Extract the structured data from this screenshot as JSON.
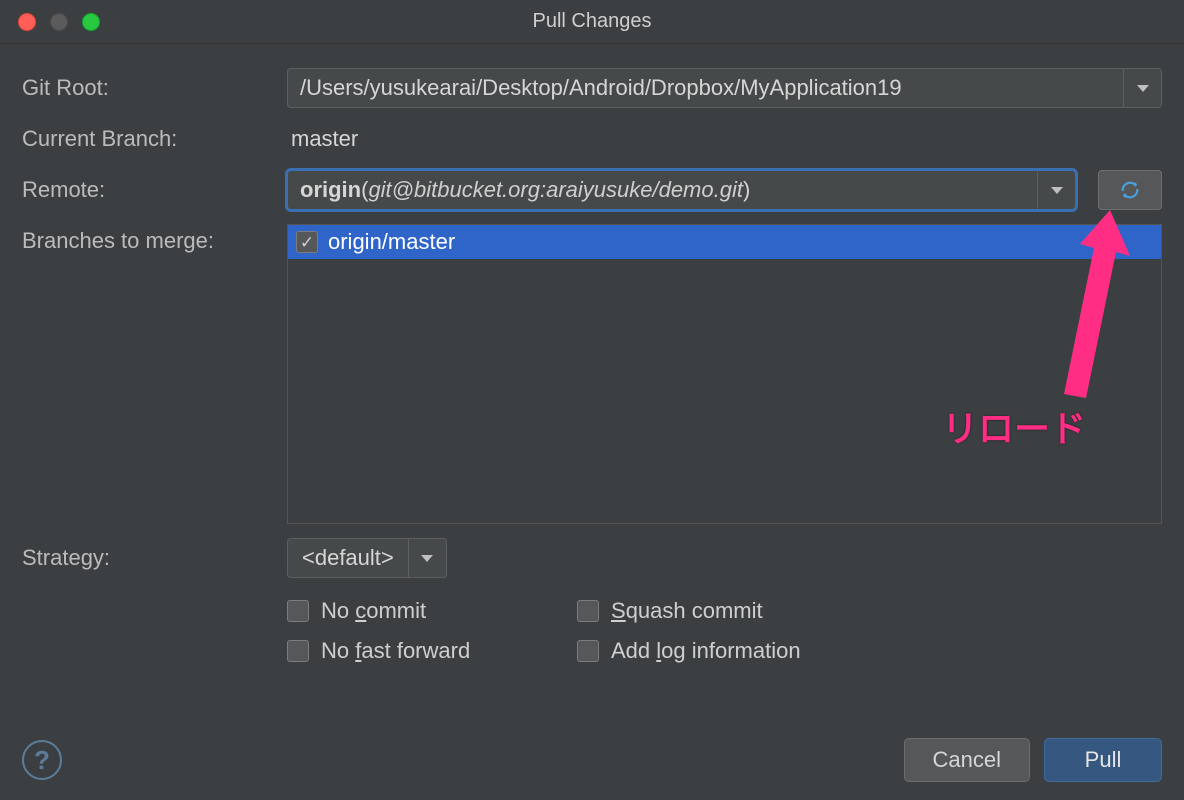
{
  "window": {
    "title": "Pull Changes"
  },
  "labels": {
    "git_root": "Git Root:",
    "current_branch": "Current Branch:",
    "remote": "Remote:",
    "branches_to_merge": "Branches to merge:",
    "strategy": "Strategy:"
  },
  "git_root": {
    "value": "/Users/yusukearai/Desktop/Android/Dropbox/MyApplication19"
  },
  "current_branch": "master",
  "remote": {
    "name": "origin",
    "url": "git@bitbucket.org:araiyusuke/demo.git"
  },
  "branches": [
    {
      "label": "origin/master",
      "checked": true,
      "selected": true
    }
  ],
  "strategy": {
    "value": "<default>"
  },
  "options": {
    "no_commit": {
      "text_before": "No ",
      "key": "c",
      "text_after": "ommit",
      "checked": false
    },
    "squash_commit": {
      "text_before": "",
      "key": "S",
      "text_after": "quash commit",
      "checked": false
    },
    "no_fast_forward": {
      "text_before": "No ",
      "key": "f",
      "text_after": "ast forward",
      "checked": false
    },
    "add_log_info": {
      "text_before": "Add ",
      "key": "l",
      "text_after": "og information",
      "checked": false
    }
  },
  "buttons": {
    "cancel": "Cancel",
    "pull": "Pull",
    "help": "?"
  },
  "annotation": {
    "label": "リロード"
  },
  "colors": {
    "accent": "#2f65c8",
    "annotation": "#ff2d84"
  }
}
